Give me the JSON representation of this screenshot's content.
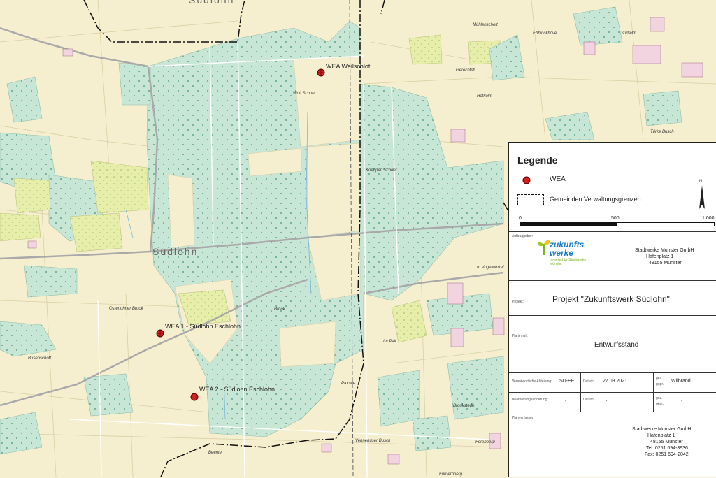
{
  "map": {
    "places": {
      "town": "Südlohn",
      "town_top": "Südlohn",
      "muehlenschott": "Mühlenschott",
      "ebbinckhoeve": "Ebbinckhöve",
      "suedfeld": "Südfeld",
      "gerechtsh": "Gerechtsh",
      "hofkoeln": "Hofkolm",
      "wolt_schoer": "Wolt Schoer",
      "tueske_busch": "Türke Busch",
      "koeppen_schoer": "Koeppen Schoer",
      "osterlohner_brook": "Osterlohner Brook",
      "brook": "Brook",
      "im_vogelwinkel": "In Vogelwinkel",
      "im_pall": "Im Pall",
      "busenschott": "Busenschott",
      "beente": "Beente",
      "vennehuser_busch": "Vennehuser Busch",
      "brooktstede": "Brookstede",
      "paxsee": "Paxsee",
      "fereboerg": "Fereboerg",
      "paxdorf": "Fürnerboerg"
    },
    "turbines": [
      {
        "label": "WEA Weilschlot"
      },
      {
        "label": "WEA 1 - Südlohn Eschlohn"
      },
      {
        "label": "WEA 2 - Südlohn Eschlohn"
      }
    ]
  },
  "legend": {
    "title": "Legende",
    "items": [
      {
        "label": "WEA",
        "color": "#d42020"
      },
      {
        "label": "Gemeinden  Verwaltungsgrenzen"
      }
    ],
    "scale": {
      "labels": [
        "0",
        "500",
        "1.000"
      ]
    }
  },
  "titleblock": {
    "client_caption": "Auftraggeber:",
    "logo_main": "zukunfts",
    "logo_main2": "werke",
    "logo_sub": "powered by Stadtwerke Münster",
    "client_name": "Stadtwerke Munster GmbH",
    "client_street": "Hafenplatz 1",
    "client_city": "48155 Münster",
    "project_caption": "Projekt:",
    "project_title": "Projekt \"Zukunftswerk Südlohn\"",
    "plan_caption": "Planinhalt:",
    "plan_title": "Entwurfsstand",
    "dept_caption": "Verantwortliche Abteilung:",
    "dept_value": "SU-EE",
    "date_caption": "Datum:",
    "date_value": "27.08.2021",
    "gez_caption": "gez.",
    "gepr_caption": "gepr.",
    "gez_value": "Wilbrand",
    "change_caption": "Bearbeitungsänderung:",
    "change_date_caption": "Datum:",
    "dash1": "-",
    "dash2": "-",
    "dash3": "-",
    "creator_caption": "Planverfasser:",
    "creator_name": "Stadtwerke Munster GmbH",
    "creator_street": "Hafenplatz 1",
    "creator_city": "48155 Munster",
    "creator_tel": "Tel: 0251 694-3936",
    "creator_fax": "Fax: 0251 694-2042"
  },
  "colors": {
    "forest": "#c8e6d6",
    "farmland": "#f6efcf",
    "meadow": "#e9efb0",
    "border": "#111111",
    "wea": "#d42020"
  }
}
